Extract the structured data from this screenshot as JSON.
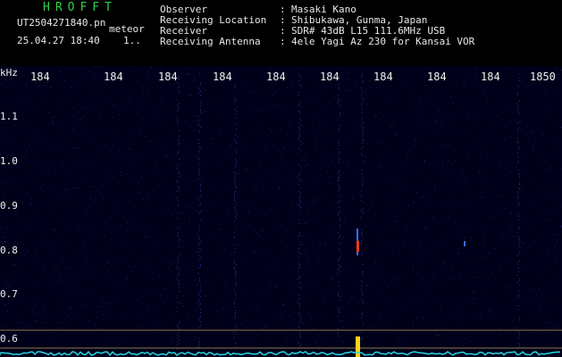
{
  "app": {
    "brand": "HROFFT",
    "filename": "UT2504271840.pn",
    "meteor_label": "meteor",
    "datetime": "25.04.27 18:40",
    "counter": "1.."
  },
  "info": [
    {
      "label": "Observer",
      "value": "Masaki Kano"
    },
    {
      "label": "Receiving Location",
      "value": "Shibukawa, Gunma, Japan"
    },
    {
      "label": "Receiver",
      "value": "SDR# 43dB L15 111.6MHz USB"
    },
    {
      "label": "Receiving Antenna",
      "value": "4ele Yagi Az 230 for Kansai VOR"
    }
  ],
  "axis": {
    "y_unit": "kHz",
    "x_ticks": [
      "184",
      "184",
      "184",
      "184",
      "184",
      "184",
      "184",
      "184",
      "184",
      "1850"
    ],
    "y_ticks": [
      "1.1",
      "1.0",
      "0.9",
      "0.8",
      "0.7",
      "0.6"
    ]
  },
  "colors": {
    "background": "#00001a",
    "header_text": "#e8e8e8",
    "brand": "#2fd24a",
    "echo_red": "#ff3a1a",
    "echo_blue": "#3a6bff",
    "signal": "#ffd21a",
    "baseline_cyan": "#27d6e6"
  }
}
